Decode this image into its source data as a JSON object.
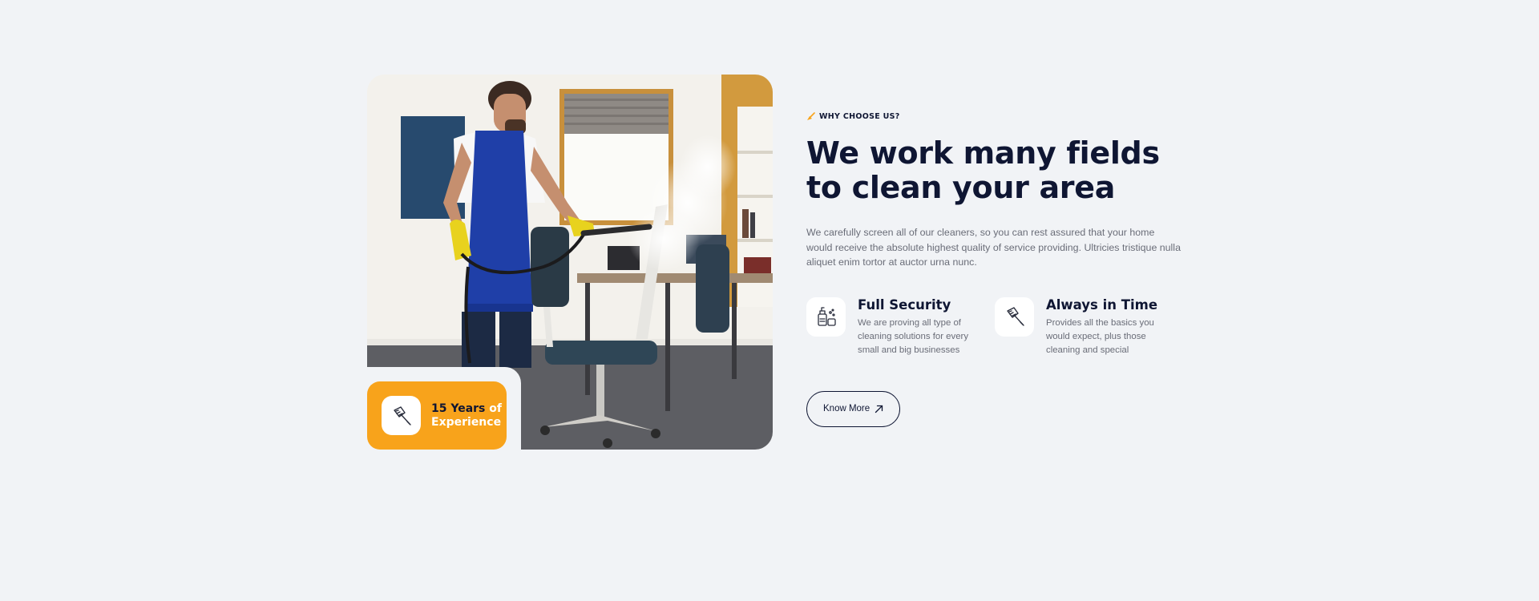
{
  "badge": {
    "line1_a": "15 Years",
    "line1_b": "of",
    "line2": "Experience",
    "icon": "cleaning-brush-icon"
  },
  "section": {
    "eyebrow": "WHY CHOOSE US?",
    "eyebrow_icon": "broom-icon",
    "title": "We work many fields to clean your area",
    "lead": "We carefully screen all of our cleaners, so you can rest assured that your home would receive the absolute highest quality of service providing. Ultricies tristique nulla aliquet enim tortor at auctor urna nunc."
  },
  "features": [
    {
      "icon": "cleaning-supplies-icon",
      "title": "Full Security",
      "desc": "We are proving all type of cleaning solutions for every small and big businesses"
    },
    {
      "icon": "cleaning-brush-icon",
      "title": "Always in Time",
      "desc": "Provides all the basics you would expect, plus those cleaning and special"
    }
  ],
  "cta": {
    "label": "Know More",
    "icon": "arrow-up-right-icon"
  },
  "colors": {
    "background": "#f1f3f6",
    "accent": "#f8a31b",
    "heading": "#0f1633",
    "body_text": "#6a6d78"
  }
}
